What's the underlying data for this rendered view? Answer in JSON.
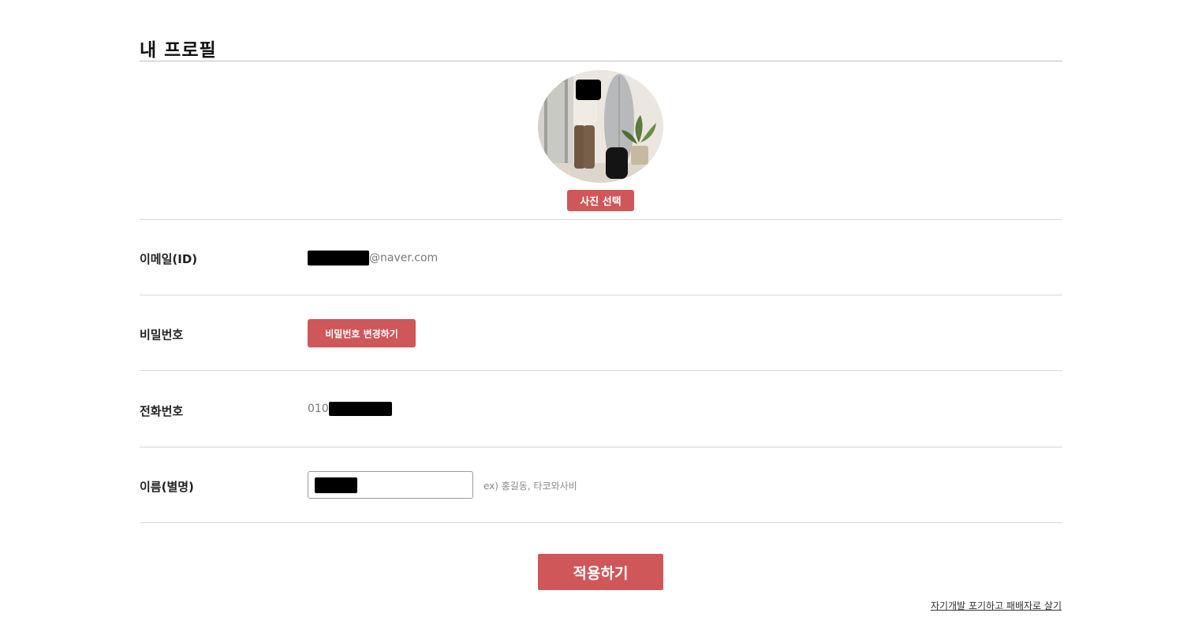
{
  "profile": {
    "title": "내 프로필",
    "photo_button": "사진 선택"
  },
  "fields": {
    "email": {
      "label": "이메일(ID)",
      "value_suffix": "@naver.com"
    },
    "password": {
      "label": "비밀번호",
      "button": "비밀번호 변경하기"
    },
    "phone": {
      "label": "전화번호",
      "value_prefix": "010"
    },
    "name": {
      "label": "이름(별명)",
      "hint": "ex) 홍길동, 타코와사비"
    }
  },
  "actions": {
    "apply": "적용하기",
    "give_up_link": "자기개발 포기하고 패배자로 살기"
  },
  "colors": {
    "accent": "#cf5759",
    "divider": "#d8d8d8",
    "redaction": "#000000"
  },
  "icons": {
    "avatar": "profile-photo"
  }
}
